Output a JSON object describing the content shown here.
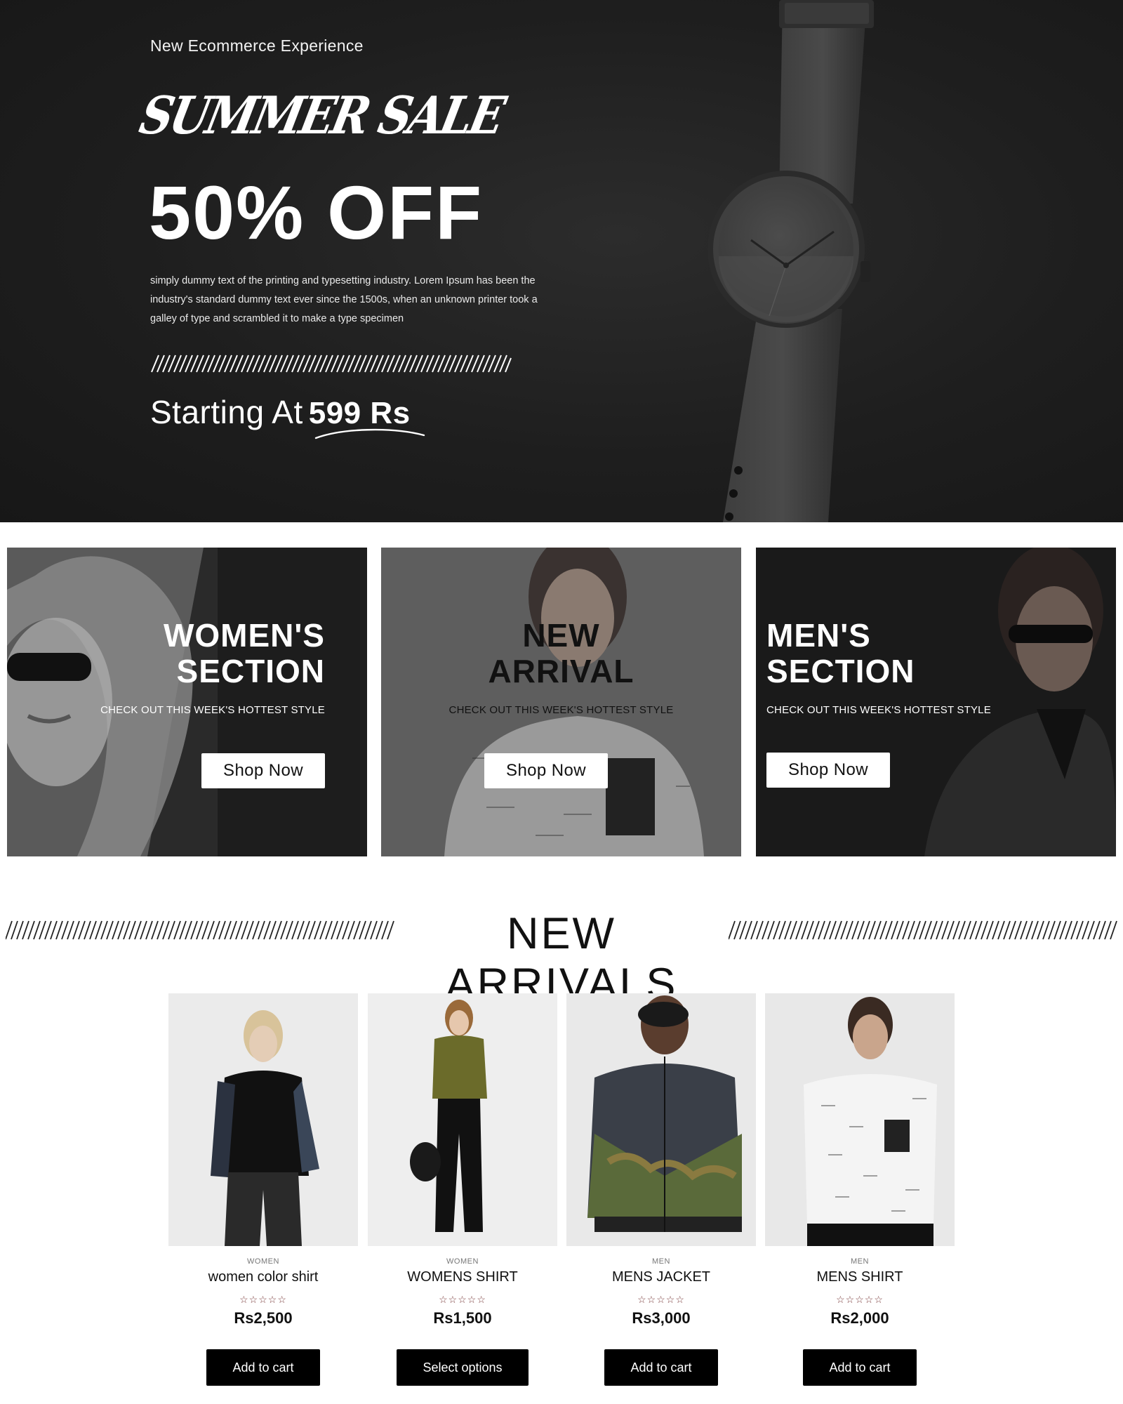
{
  "hero": {
    "eyebrow": "New Ecommerce Experience",
    "script_title": "SUMMER SALE",
    "discount": "50% OFF",
    "body": " simply dummy text of the printing and typesetting industry. Lorem Ipsum has been the industry's standard dummy text ever since the 1500s, when an unknown printer took a galley of type and scrambled it to make a type specimen",
    "price_label": "Starting At",
    "price_value": "599 Rs"
  },
  "banners": [
    {
      "title_line1": "WOMEN'S",
      "title_line2": "SECTION",
      "subtitle": "CHECK OUT THIS WEEK'S HOTTEST STYLE",
      "button": "Shop Now"
    },
    {
      "title_line1": "NEW",
      "title_line2": "ARRIVAL",
      "subtitle": "CHECK OUT THIS WEEK'S HOTTEST STYLE",
      "button": "Shop Now"
    },
    {
      "title_line1": "MEN'S",
      "title_line2": "SECTION",
      "subtitle": "CHECK OUT THIS WEEK'S HOTTEST STYLE",
      "button": "Shop Now"
    }
  ],
  "new_arrivals": {
    "title": "NEW ARRIVALS",
    "products": [
      {
        "category": "WOMEN",
        "name": "women color shirt",
        "rating": "☆☆☆☆☆",
        "price": "Rs2,500",
        "button": "Add to cart"
      },
      {
        "category": "WOMEN",
        "name": "WOMENS SHIRT",
        "rating": "☆☆☆☆☆",
        "price": "Rs1,500",
        "button": "Select options"
      },
      {
        "category": "MEN",
        "name": "MENS JACKET",
        "rating": "☆☆☆☆☆",
        "price": "Rs3,000",
        "button": "Add to cart"
      },
      {
        "category": "MEN",
        "name": "MENS SHIRT",
        "rating": "☆☆☆☆☆",
        "price": "Rs2,000",
        "button": "Add to cart"
      }
    ]
  },
  "colors": {
    "hero_bg": "#1e1e1e",
    "button_dark": "#000000",
    "button_light": "#ffffff",
    "star_color": "#7a3b3b"
  }
}
